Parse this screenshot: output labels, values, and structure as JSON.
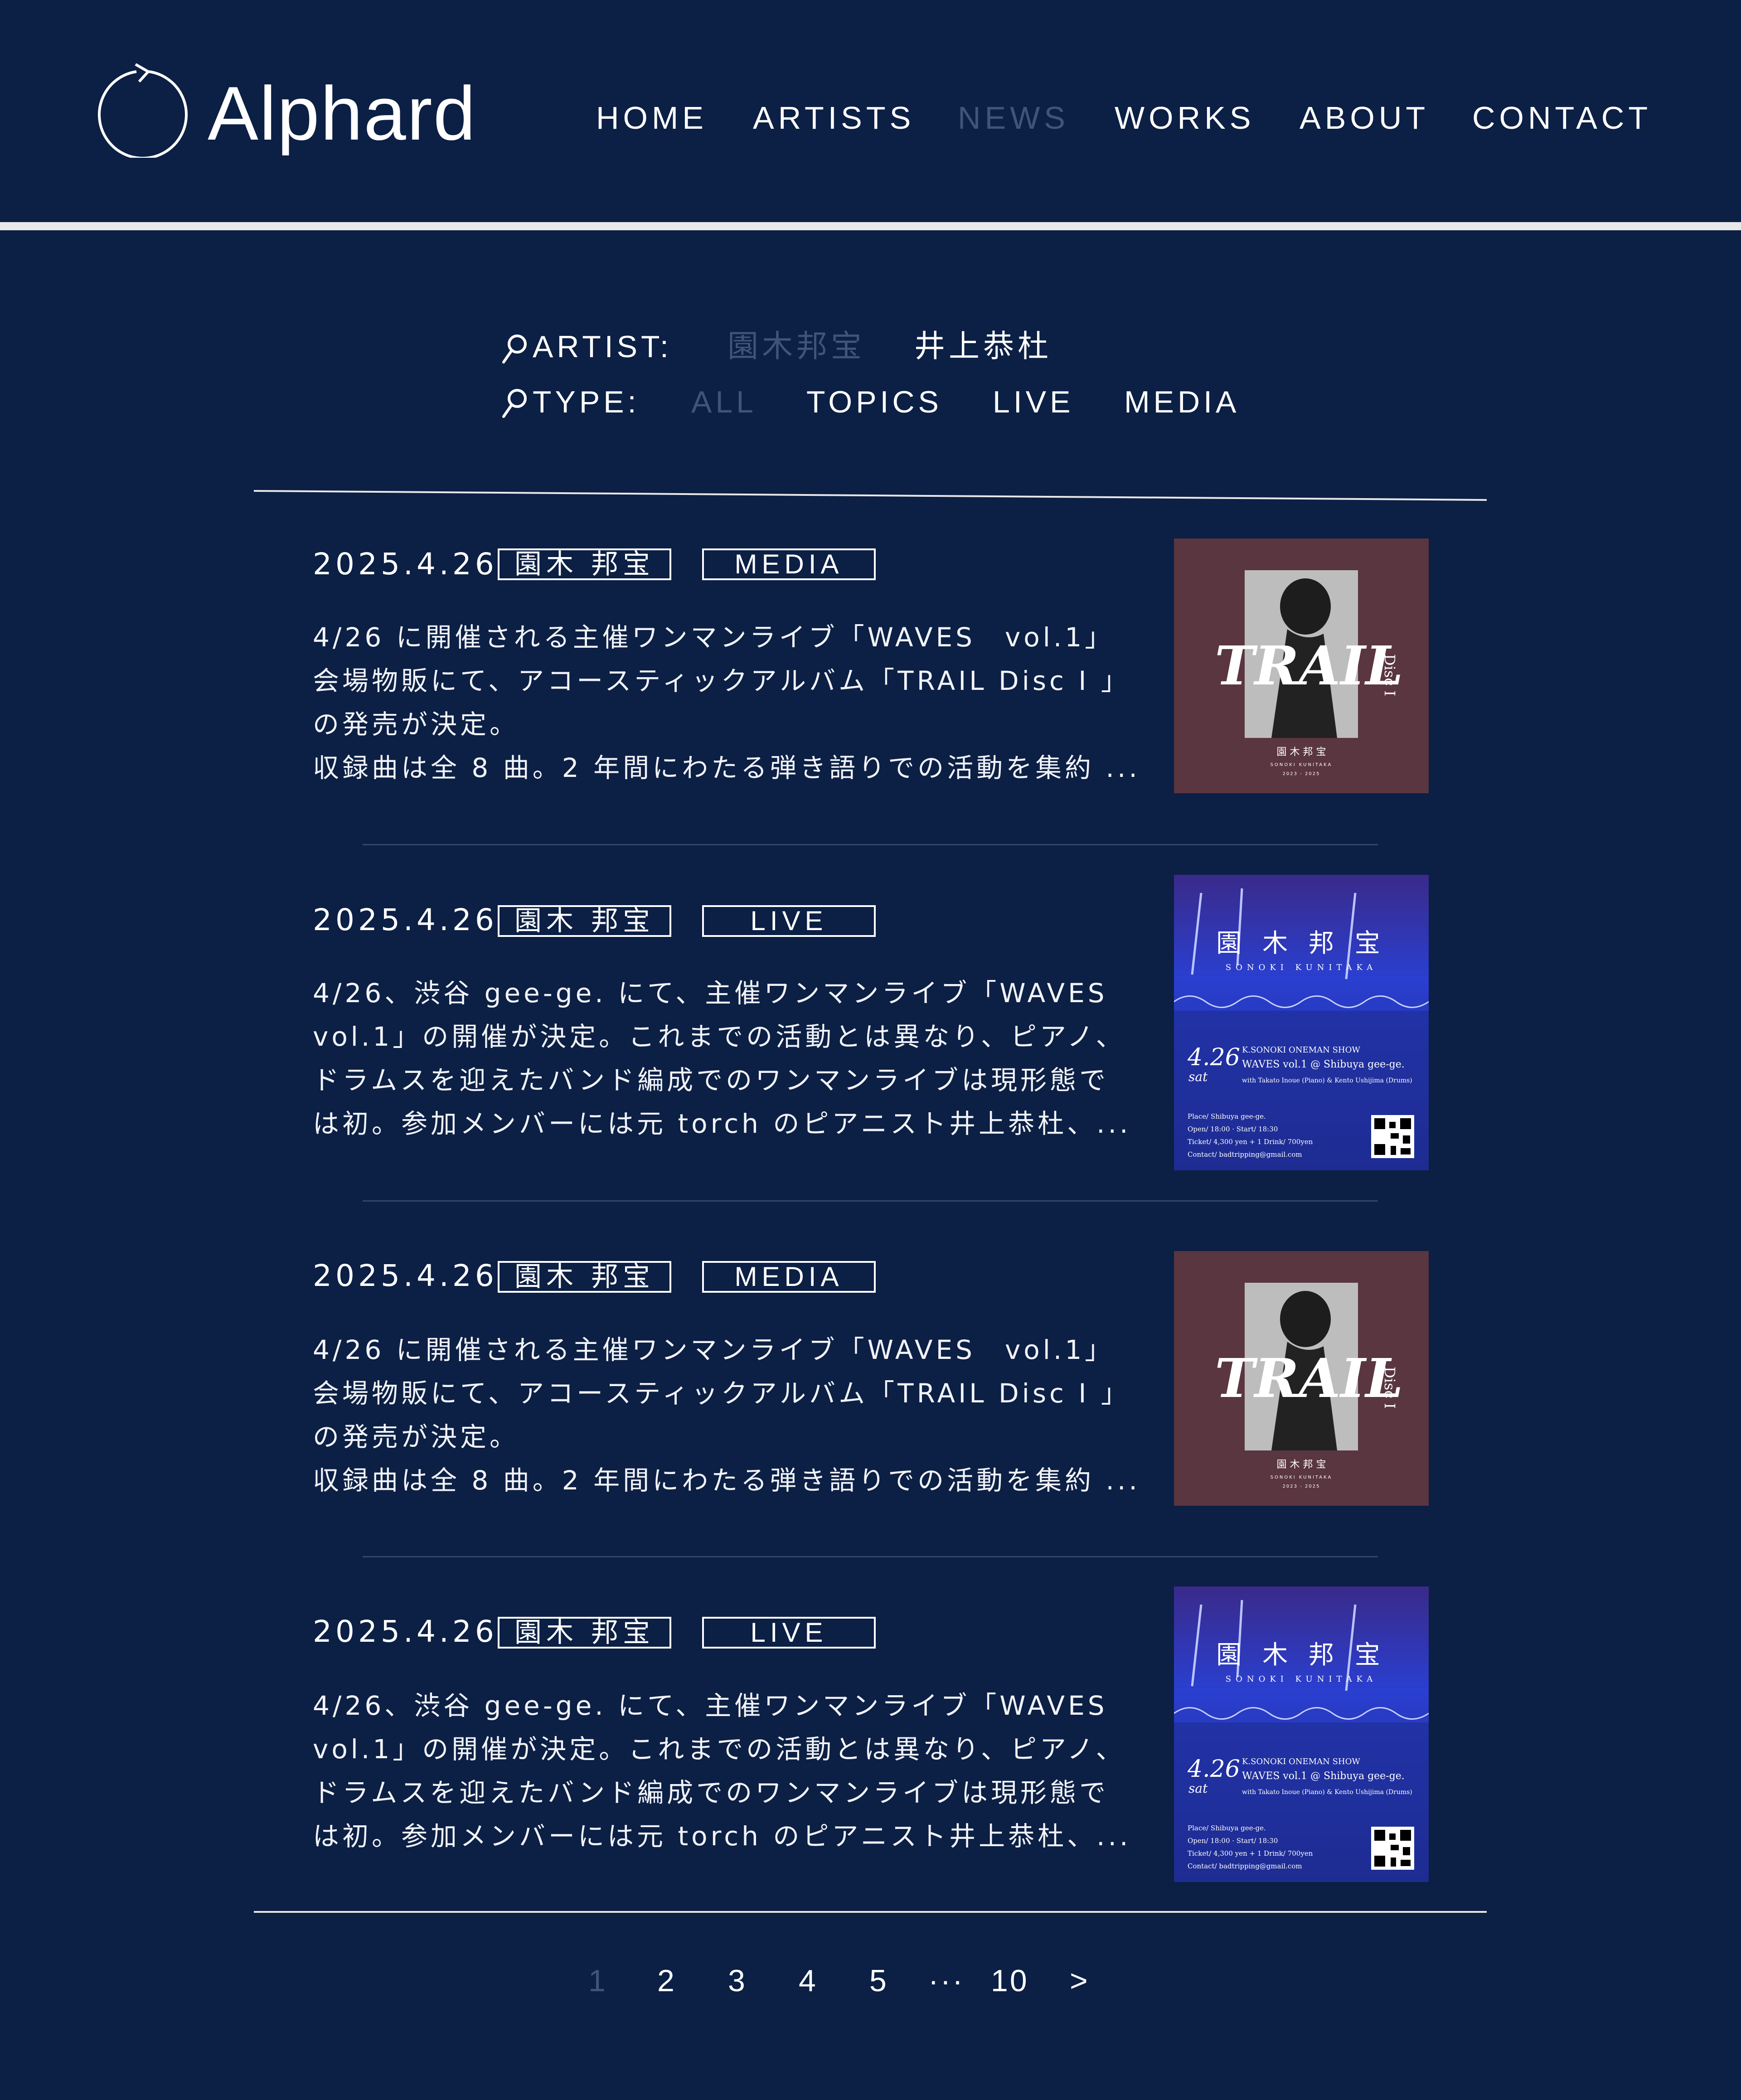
{
  "header": {
    "logo_text": "Alphard",
    "nav": [
      {
        "label": "HOME",
        "active": false
      },
      {
        "label": "ARTISTS",
        "active": false
      },
      {
        "label": "NEWS",
        "active": true
      },
      {
        "label": "WORKS",
        "active": false
      },
      {
        "label": "ABOUT",
        "active": false
      },
      {
        "label": "CONTACT",
        "active": false
      }
    ]
  },
  "filters": {
    "artist_label": "ARTIST:",
    "artists": [
      {
        "label": "園木邦宝",
        "active": true
      },
      {
        "label": "井上恭杜",
        "active": false
      }
    ],
    "type_label": "TYPE:",
    "types": [
      {
        "label": "ALL",
        "active": true
      },
      {
        "label": "TOPICS",
        "active": false
      },
      {
        "label": "LIVE",
        "active": false
      },
      {
        "label": "MEDIA",
        "active": false
      }
    ]
  },
  "news": [
    {
      "date": "2025.4.26",
      "artist_tag": "園木 邦宝",
      "type_tag": "MEDIA",
      "lines": [
        "4/26 に開催される主催ワンマンライブ「WAVES　vol.1」",
        "会場物販にて、アコースティックアルバム「TRAIL Disc I 」",
        "の発売が決定。",
        "収録曲は全 8 曲。2 年間にわたる弾き語りでの活動を集約 ..."
      ],
      "thumb": {
        "type": "album",
        "title": "TRAIL",
        "side": "Disc I",
        "artist": "園 木 邦 宝",
        "romaji": "SONOKI KUNITAKA",
        "years": "2023 - 2025"
      }
    },
    {
      "date": "2025.4.26",
      "artist_tag": "園木 邦宝",
      "type_tag": "LIVE",
      "lines": [
        "4/26、渋谷 gee-ge. にて、主催ワンマンライブ「WAVES",
        "vol.1」の開催が決定。これまでの活動とは異なり、ピアノ、",
        "ドラムスを迎えたバンド編成でのワンマンライブは現形態で",
        "は初。参加メンバーには元 torch のピアニスト井上恭杜、..."
      ],
      "thumb": {
        "type": "flyer",
        "name": "園 木 邦 宝",
        "romaji": "SONOKI KUNITAKA",
        "date": "4.26",
        "day": "sat",
        "show": "K.SONOKI ONEMAN SHOW",
        "title": "WAVES vol.1 @ Shibuya gee-ge.",
        "with": "with Takato Inoue (Piano) & Kento Ushijima (Drums)",
        "place": "Place/ Shibuya gee-ge.",
        "open": "Open/ 18:00 · Start/ 18:30",
        "ticket": "Ticket/ 4,300 yen + 1 Drink/ 700yen",
        "contact": "Contact/ badtripping@gmail.com"
      }
    },
    {
      "date": "2025.4.26",
      "artist_tag": "園木 邦宝",
      "type_tag": "MEDIA",
      "lines": [
        "4/26 に開催される主催ワンマンライブ「WAVES　vol.1」",
        "会場物販にて、アコースティックアルバム「TRAIL Disc I 」",
        "の発売が決定。",
        "収録曲は全 8 曲。2 年間にわたる弾き語りでの活動を集約 ..."
      ],
      "thumb": {
        "type": "album",
        "title": "TRAIL",
        "side": "Disc I",
        "artist": "園 木 邦 宝",
        "romaji": "SONOKI KUNITAKA",
        "years": "2023 - 2025"
      }
    },
    {
      "date": "2025.4.26",
      "artist_tag": "園木 邦宝",
      "type_tag": "LIVE",
      "lines": [
        "4/26、渋谷 gee-ge. にて、主催ワンマンライブ「WAVES",
        "vol.1」の開催が決定。これまでの活動とは異なり、ピアノ、",
        "ドラムスを迎えたバンド編成でのワンマンライブは現形態で",
        "は初。参加メンバーには元 torch のピアニスト井上恭杜、..."
      ],
      "thumb": {
        "type": "flyer",
        "name": "園 木 邦 宝",
        "romaji": "SONOKI KUNITAKA",
        "date": "4.26",
        "day": "sat",
        "show": "K.SONOKI ONEMAN SHOW",
        "title": "WAVES vol.1 @ Shibuya gee-ge.",
        "with": "with Takato Inoue (Piano) & Kento Ushijima (Drums)",
        "place": "Place/ Shibuya gee-ge.",
        "open": "Open/ 18:00 · Start/ 18:30",
        "ticket": "Ticket/ 4,300 yen + 1 Drink/ 700yen",
        "contact": "Contact/ badtripping@gmail.com"
      }
    }
  ],
  "pagination": {
    "pages": [
      "1",
      "2",
      "3",
      "4",
      "5",
      "···",
      "10",
      ">"
    ],
    "current": "1"
  },
  "colors": {
    "background": "#0c1f44",
    "text": "#ffffff",
    "muted": "#3e5578",
    "album_bg": "#5a3640",
    "flyer_bg": "#1f2f9a"
  }
}
